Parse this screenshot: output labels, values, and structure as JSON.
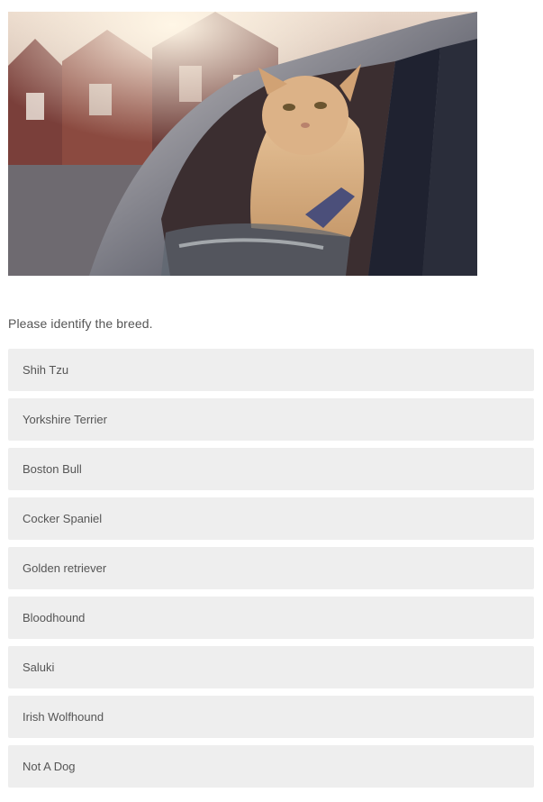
{
  "question": {
    "prompt": "Please identify the breed."
  },
  "image": {
    "subject": "cat-in-car-window"
  },
  "options": [
    {
      "label": "Shih Tzu"
    },
    {
      "label": "Yorkshire Terrier"
    },
    {
      "label": "Boston Bull"
    },
    {
      "label": "Cocker Spaniel"
    },
    {
      "label": "Golden retriever"
    },
    {
      "label": "Bloodhound"
    },
    {
      "label": "Saluki"
    },
    {
      "label": "Irish Wolfhound"
    },
    {
      "label": "Not A Dog"
    }
  ],
  "colors": {
    "option_bg": "#eeeeee",
    "text": "#555555"
  }
}
